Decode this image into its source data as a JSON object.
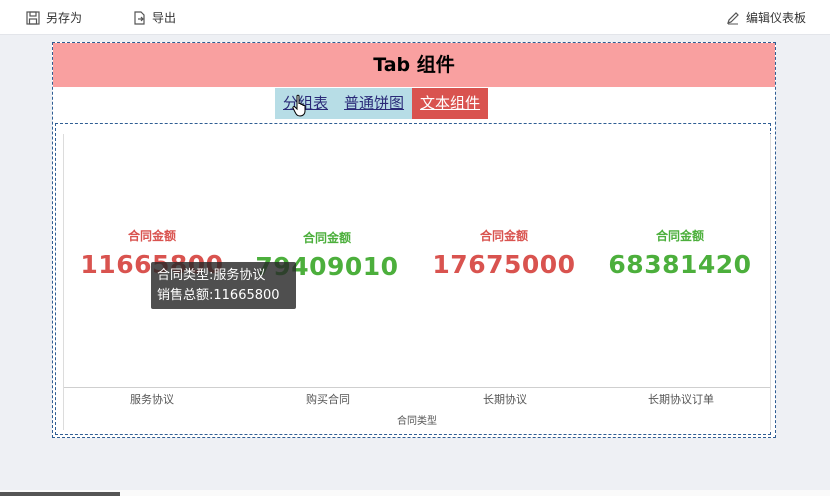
{
  "toolbar": {
    "save_as_label": "另存为",
    "export_label": "导出",
    "edit_label": "编辑仪表板"
  },
  "widget": {
    "title": "Tab 组件",
    "tabs": [
      "分组表",
      "普通饼图",
      "文本组件"
    ],
    "active_tab": "文本组件"
  },
  "colors": {
    "title_bg": "#f9a0a0",
    "red": "#d9534f",
    "green": "#4caf3c",
    "tab_bg": "#b7dde6"
  },
  "chart_data": {
    "type": "table",
    "xlabel": "合同类型",
    "categories": [
      "服务协议",
      "购买合同",
      "长期协议",
      "长期协议订单"
    ],
    "series": [
      {
        "name": "合同金额",
        "values": [
          11665800,
          79409010,
          17675000,
          68381420
        ]
      }
    ],
    "label_colors": [
      "red",
      "green",
      "red",
      "green"
    ]
  },
  "tooltip": {
    "line1": "合同类型:服务协议",
    "line2": "销售总额:11665800"
  },
  "display": {
    "values": [
      "11665800",
      "79409010",
      "17675000",
      "68381420"
    ]
  }
}
